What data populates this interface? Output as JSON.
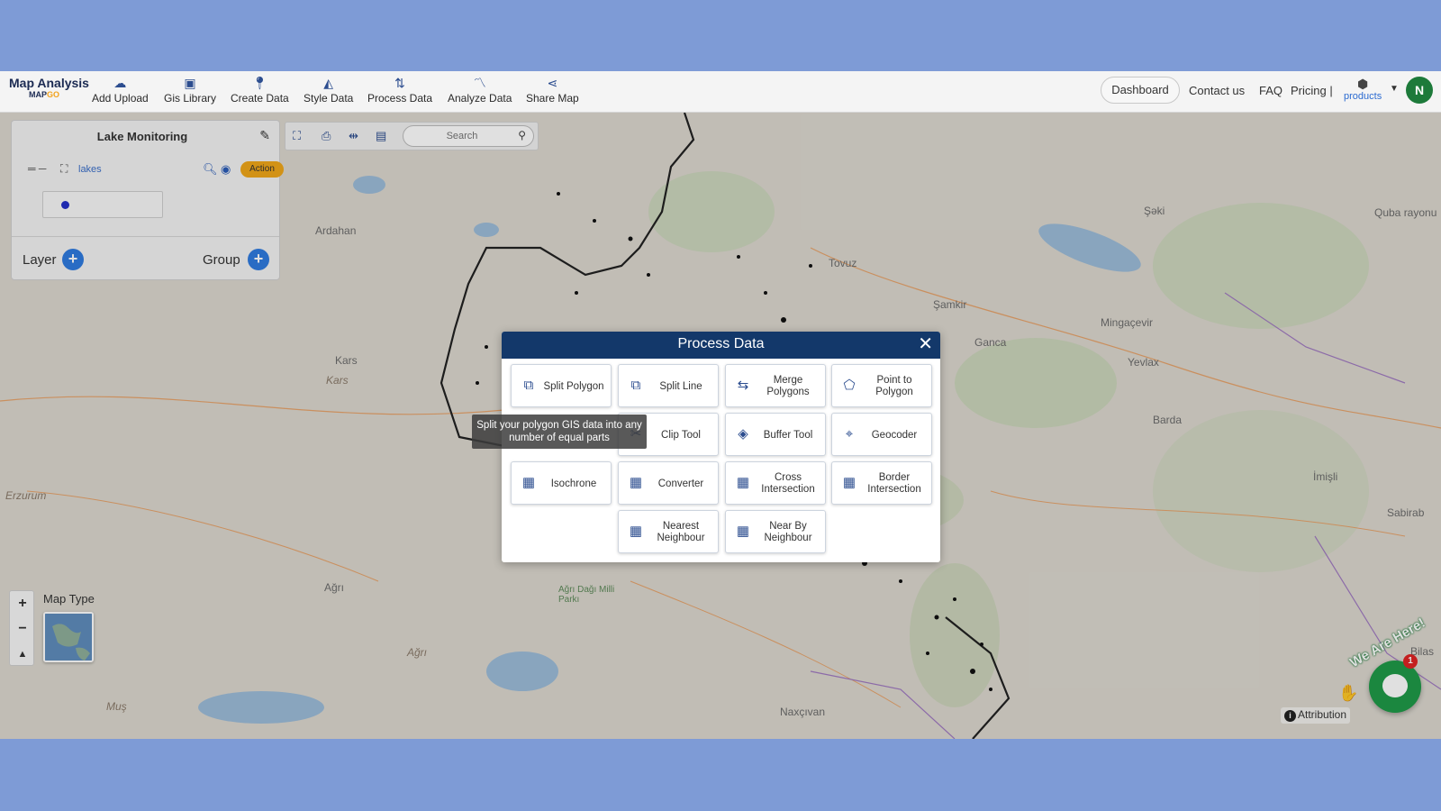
{
  "brand": {
    "title": "Map Analysis",
    "sub_a": "MAP",
    "sub_b": "GO"
  },
  "nav": [
    {
      "label": "Add Upload",
      "icon": "cloud-upload-icon",
      "glyph": "☁"
    },
    {
      "label": "Gis Library",
      "icon": "library-icon",
      "glyph": "▣"
    },
    {
      "label": "Create Data",
      "icon": "map-pin-icon",
      "glyph": "⬤"
    },
    {
      "label": "Style Data",
      "icon": "paint-bucket-icon",
      "glyph": "◭"
    },
    {
      "label": "Process Data",
      "icon": "process-icon",
      "glyph": "⇅"
    },
    {
      "label": "Analyze Data",
      "icon": "analyze-chart-icon",
      "glyph": "〽"
    },
    {
      "label": "Share Map",
      "icon": "share-icon",
      "glyph": "⋖"
    }
  ],
  "topright": {
    "dashboard": "Dashboard",
    "contact": "Contact us",
    "faq": "FAQ",
    "pricing": "Pricing |",
    "products": "products",
    "avatar_initial": "N"
  },
  "layer_panel": {
    "title": "Lake Monitoring",
    "layer_name": "lakes",
    "action": "Action",
    "layer_label": "Layer",
    "group_label": "Group"
  },
  "search": {
    "placeholder": "Search"
  },
  "map_labels": [
    "Ardahan",
    "Kars",
    "Kars",
    "Erzurum",
    "Ağrı",
    "Ağrı",
    "Muş",
    "Tovuz",
    "Şamkir",
    "Ganca",
    "Mingaçevir",
    "Yevlax",
    "Barda",
    "Şəki",
    "Quba rayonu",
    "İmişli",
    "Sabirab",
    "Bilas",
    "Naxçıvan",
    "Ağrı Dağı Milli Parkı"
  ],
  "modal": {
    "title": "Process Data",
    "tools": [
      {
        "label": "Split Polygon",
        "icon": "split-polygon-icon"
      },
      {
        "label": "Split Line",
        "icon": "split-line-icon"
      },
      {
        "label": "Merge Polygons",
        "icon": "merge-polygons-icon"
      },
      {
        "label": "Point to Polygon",
        "icon": "point-to-polygon-icon"
      },
      {
        "label": "Clip Tool",
        "icon": "clip-tool-icon"
      },
      {
        "label": "Buffer Tool",
        "icon": "buffer-tool-icon"
      },
      {
        "label": "Geocoder",
        "icon": "geocoder-pin-icon"
      },
      {
        "label": "Isochrone",
        "icon": "isochrone-icon"
      },
      {
        "label": "Converter",
        "icon": "converter-icon"
      },
      {
        "label": "Cross Intersection",
        "icon": "cross-intersection-icon"
      },
      {
        "label": "Border Intersection",
        "icon": "border-intersection-icon"
      },
      {
        "label": "Nearest Neighbour",
        "icon": "nearest-neighbour-icon"
      },
      {
        "label": "Near By Neighbour",
        "icon": "nearby-neighbour-icon"
      }
    ],
    "tooltip": "Split your polygon GIS data into any number of equal parts"
  },
  "map_controls": {
    "zoom_in": "+",
    "zoom_out": "−",
    "compass": "▲",
    "map_type": "Map Type"
  },
  "attribution": "Attribution",
  "chat": {
    "tagline": "We Are Here!",
    "unread": "1"
  }
}
